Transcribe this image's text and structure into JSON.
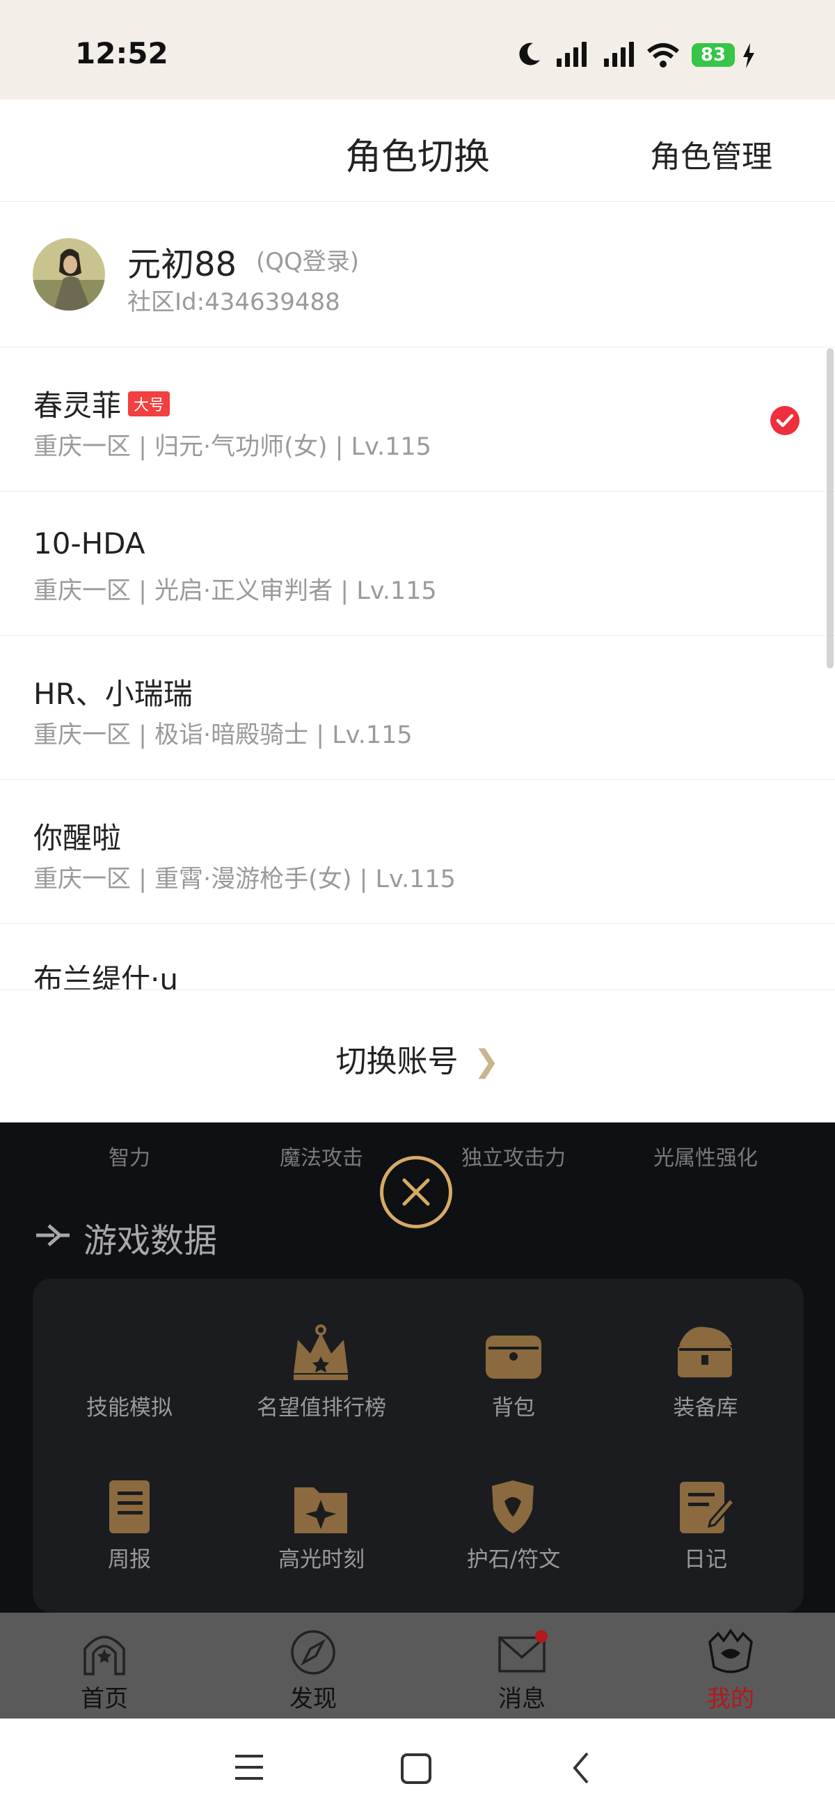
{
  "status_bar": {
    "time": "12:52",
    "battery": "83"
  },
  "header": {
    "title": "角色切换",
    "manage_label": "角色管理"
  },
  "account": {
    "name": "元初88",
    "login_type": "(QQ登录)",
    "community_id": "社区Id:434639488"
  },
  "characters": [
    {
      "name": "春灵菲",
      "badge": "大号",
      "info": "重庆一区 | 归元·气功师(女) | Lv.115",
      "selected": true
    },
    {
      "name": "10-HDA",
      "info": "重庆一区 | 光启·正义审判者 | Lv.115"
    },
    {
      "name": "HR、小瑞瑞",
      "info": "重庆一区 | 极诣·暗殿骑士 | Lv.115"
    },
    {
      "name": "你醒啦",
      "info": "重庆一区 | 重霄·漫游枪手(女) | Lv.115"
    },
    {
      "name": "布兰缇什·u"
    }
  ],
  "switch_account": {
    "label": "切换账号"
  },
  "background": {
    "stats": [
      "智力",
      "魔法攻击",
      "独立攻击力",
      "光属性强化"
    ],
    "section_title": "游戏数据",
    "grid_items": [
      {
        "label": "技能模拟",
        "icon": "skill-sim-icon"
      },
      {
        "label": "名望值排行榜",
        "icon": "crown-icon"
      },
      {
        "label": "背包",
        "icon": "bag-icon"
      },
      {
        "label": "装备库",
        "icon": "chest-icon"
      },
      {
        "label": "周报",
        "icon": "scroll-icon"
      },
      {
        "label": "高光时刻",
        "icon": "folder-star-icon"
      },
      {
        "label": "护石/符文",
        "icon": "shield-icon"
      },
      {
        "label": "日记",
        "icon": "diary-icon"
      }
    ]
  },
  "tabs": [
    {
      "label": "首页",
      "icon": "home-arch-icon"
    },
    {
      "label": "发现",
      "icon": "compass-icon"
    },
    {
      "label": "消息",
      "icon": "mail-icon"
    },
    {
      "label": "我的",
      "icon": "profile-crest-icon",
      "color": "#b2191c"
    }
  ],
  "colors": {
    "accent_red": "#ee2f3d",
    "gold": "#d7aa66",
    "active_tab": "#b2191c"
  }
}
